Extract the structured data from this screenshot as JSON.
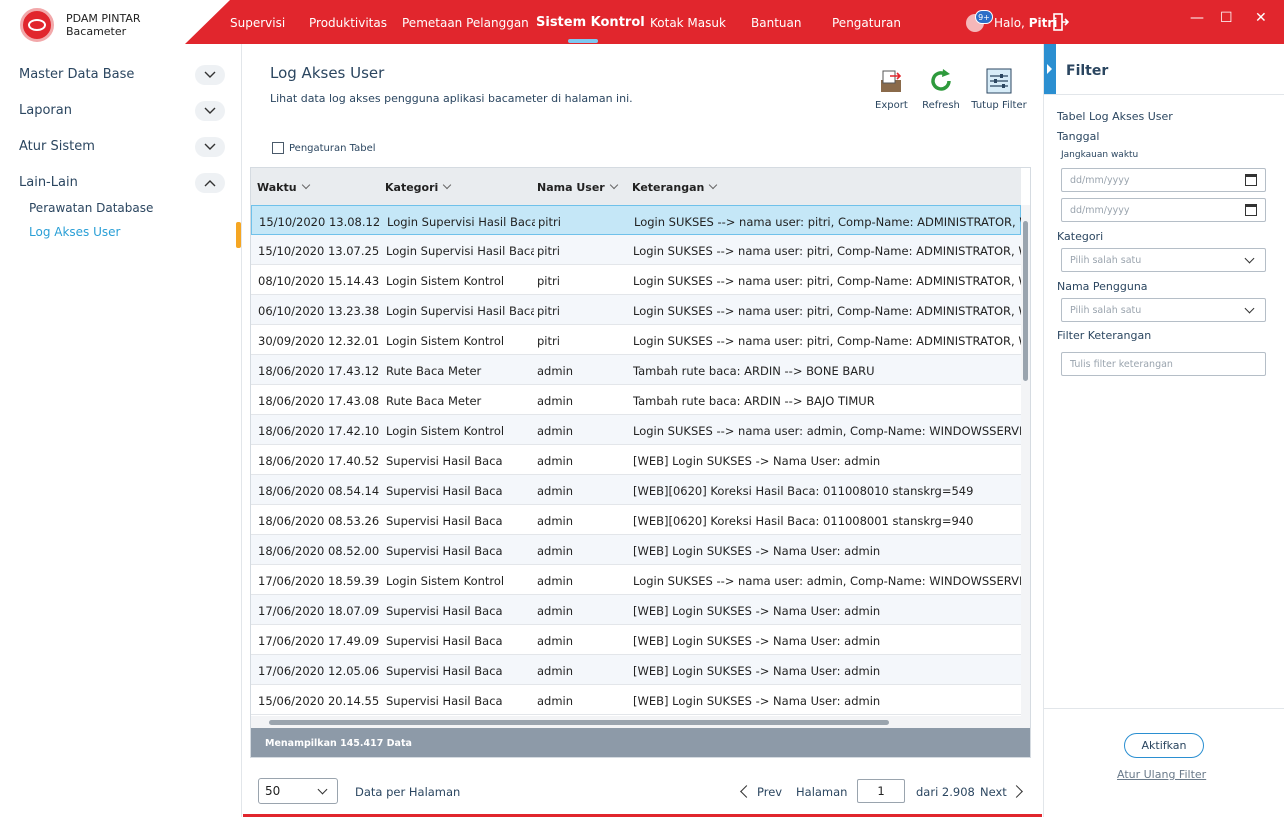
{
  "app": {
    "name_line1": "PDAM PINTAR",
    "name_line2": "Bacameter",
    "notification_badge": "9+",
    "greeting": "Halo,",
    "user": "Pitri"
  },
  "nav": [
    {
      "label": "Supervisi"
    },
    {
      "label": "Produktivitas"
    },
    {
      "label": "Pemetaan Pelanggan"
    },
    {
      "label": "Sistem Kontrol"
    },
    {
      "label": "Kotak Masuk"
    },
    {
      "label": "Bantuan"
    },
    {
      "label": "Pengaturan"
    }
  ],
  "sidebar": {
    "sections": [
      {
        "label": "Master Data Base"
      },
      {
        "label": "Laporan"
      },
      {
        "label": "Atur Sistem"
      },
      {
        "label": "Lain-Lain"
      }
    ],
    "sub_items": [
      {
        "label": "Perawatan Database"
      },
      {
        "label": "Log Akses User"
      }
    ]
  },
  "page": {
    "title": "Log Akses User",
    "description": "Lihat data log akses pengguna aplikasi bacameter di halaman ini.",
    "toolbar": {
      "export": "Export",
      "refresh": "Refresh",
      "close_filter": "Tutup Filter"
    },
    "table_settings": "Pengaturan Tabel"
  },
  "table": {
    "headers": [
      "Waktu",
      "Kategori",
      "Nama User",
      "Keterangan"
    ],
    "rows": [
      [
        "15/10/2020 13.08.12",
        "Login Supervisi Hasil Baca",
        "pitri",
        "Login SUKSES --> nama user: pitri, Comp-Name: ADMINISTRATOR, Win-User"
      ],
      [
        "15/10/2020 13.07.25",
        "Login Supervisi Hasil Baca",
        "pitri",
        "Login SUKSES --> nama user: pitri, Comp-Name: ADMINISTRATOR, Win-User"
      ],
      [
        "08/10/2020 15.14.43",
        "Login Sistem Kontrol",
        "pitri",
        "Login SUKSES --> nama user: pitri, Comp-Name: ADMINISTRATOR, Win-User"
      ],
      [
        "06/10/2020 13.23.38",
        "Login Supervisi Hasil Baca",
        "pitri",
        "Login SUKSES --> nama user: pitri, Comp-Name: ADMINISTRATOR, Win-User"
      ],
      [
        "30/09/2020 12.32.01",
        "Login Sistem Kontrol",
        "pitri",
        "Login SUKSES --> nama user: pitri, Comp-Name: ADMINISTRATOR, Win-User"
      ],
      [
        "18/06/2020 17.43.12",
        "Rute Baca Meter",
        "admin",
        "Tambah rute baca: ARDIN --> BONE BARU"
      ],
      [
        "18/06/2020 17.43.08",
        "Rute Baca Meter",
        "admin",
        "Tambah rute baca: ARDIN --> BAJO TIMUR"
      ],
      [
        "18/06/2020 17.42.10",
        "Login Sistem Kontrol",
        "admin",
        "Login SUKSES --> nama user: admin, Comp-Name: WINDOWSSERVER, Win-User"
      ],
      [
        "18/06/2020 17.40.52",
        "Supervisi Hasil Baca",
        "admin",
        "[WEB] Login SUKSES -> Nama User: admin"
      ],
      [
        "18/06/2020 08.54.14",
        "Supervisi Hasil Baca",
        "admin",
        "[WEB][0620] Koreksi Hasil Baca: 011008010 stanskrg=549"
      ],
      [
        "18/06/2020 08.53.26",
        "Supervisi Hasil Baca",
        "admin",
        "[WEB][0620] Koreksi Hasil Baca: 011008001 stanskrg=940"
      ],
      [
        "18/06/2020 08.52.00",
        "Supervisi Hasil Baca",
        "admin",
        "[WEB] Login SUKSES -> Nama User: admin"
      ],
      [
        "17/06/2020 18.59.39",
        "Login Sistem Kontrol",
        "admin",
        "Login SUKSES --> nama user: admin, Comp-Name: WINDOWSSERVER, Win-User"
      ],
      [
        "17/06/2020 18.07.09",
        "Supervisi Hasil Baca",
        "admin",
        "[WEB] Login SUKSES -> Nama User: admin"
      ],
      [
        "17/06/2020 17.49.09",
        "Supervisi Hasil Baca",
        "admin",
        "[WEB] Login SUKSES -> Nama User: admin"
      ],
      [
        "17/06/2020 12.05.06",
        "Supervisi Hasil Baca",
        "admin",
        "[WEB] Login SUKSES -> Nama User: admin"
      ],
      [
        "15/06/2020 20.14.55",
        "Supervisi Hasil Baca",
        "admin",
        "[WEB] Login SUKSES -> Nama User: admin"
      ]
    ],
    "footer": "Menampilkan 145.417 Data"
  },
  "pager": {
    "per_page": "50",
    "per_page_label": "Data per Halaman",
    "prev": "Prev",
    "page_label": "Halaman",
    "page": "1",
    "of": "dari 2.908",
    "next": "Next"
  },
  "filter": {
    "title": "Filter",
    "table_name": "Tabel Log Akses User",
    "date_label": "Tanggal",
    "range_label": "Jangkauan waktu",
    "date_placeholder": "dd/mm/yyyy",
    "category_label": "Kategori",
    "select_placeholder": "Pilih salah satu",
    "user_label": "Nama Pengguna",
    "desc_label": "Filter Keterangan",
    "desc_placeholder": "Tulis filter keterangan",
    "apply": "Aktifkan",
    "reset": "Atur Ulang Filter"
  },
  "colors": {
    "brand_red": "#e1262d",
    "accent_blue": "#2b8fd1",
    "selected_row": "#c5e7f7",
    "active_marker": "#f5a623"
  }
}
